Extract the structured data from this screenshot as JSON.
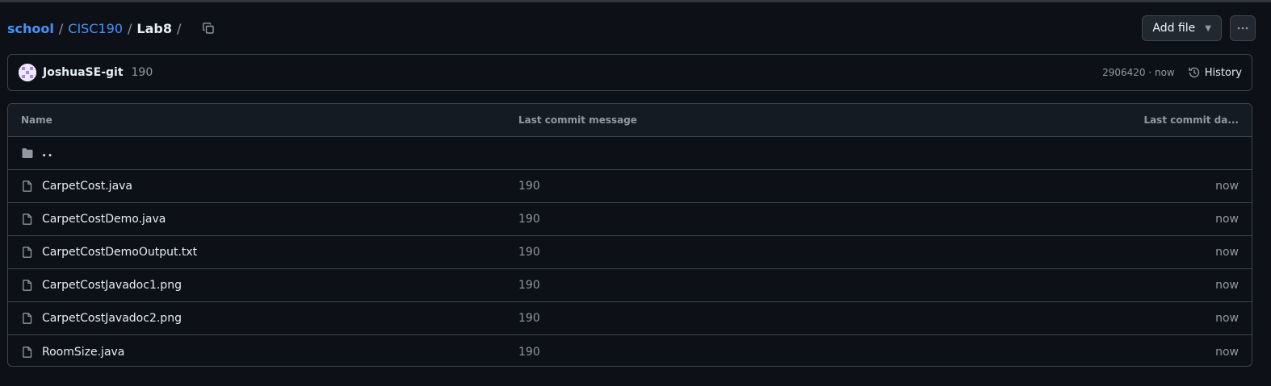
{
  "breadcrumb": {
    "root": "school",
    "items": [
      "CISC190"
    ],
    "current": "Lab8",
    "trailing_sep": "/"
  },
  "actions": {
    "add_file_label": "Add file",
    "more_label": "···"
  },
  "commit": {
    "author": "JoshuaSE-git",
    "message": "190",
    "hash_time": "2906420 · now",
    "history_label": "History"
  },
  "table": {
    "headers": {
      "name": "Name",
      "message": "Last commit message",
      "date": "Last commit da..."
    },
    "parent": "..",
    "rows": [
      {
        "name": "CarpetCost.java",
        "message": "190",
        "date": "now"
      },
      {
        "name": "CarpetCostDemo.java",
        "message": "190",
        "date": "now"
      },
      {
        "name": "CarpetCostDemoOutput.txt",
        "message": "190",
        "date": "now"
      },
      {
        "name": "CarpetCostJavadoc1.png",
        "message": "190",
        "date": "now"
      },
      {
        "name": "CarpetCostJavadoc2.png",
        "message": "190",
        "date": "now"
      },
      {
        "name": "RoomSize.java",
        "message": "190",
        "date": "now"
      }
    ]
  },
  "colors": {
    "background": "#0d1117",
    "link": "#4493f8",
    "border": "#3d444d",
    "muted": "#9198a1"
  },
  "icons": [
    "copy-icon",
    "caret-down-icon",
    "kebab-icon",
    "avatar-icon",
    "history-icon",
    "folder-icon",
    "file-icon"
  ]
}
